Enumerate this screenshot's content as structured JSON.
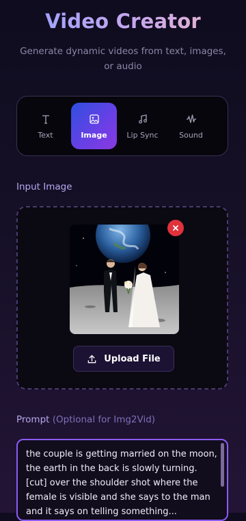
{
  "header": {
    "title": "Video Creator",
    "subtitle": "Generate dynamic videos from text, images, or audio"
  },
  "tabs": [
    {
      "label": "Text",
      "icon": "text-icon",
      "active": false
    },
    {
      "label": "Image",
      "icon": "image-icon",
      "active": true
    },
    {
      "label": "Lip Sync",
      "icon": "music-note-icon",
      "active": false
    },
    {
      "label": "Sound",
      "icon": "waveform-icon",
      "active": false
    }
  ],
  "input_image": {
    "label": "Input Image",
    "upload_label": "Upload File"
  },
  "prompt": {
    "label": "Prompt",
    "hint": "(Optional for Img2Vid)",
    "value": "the couple is getting married on the moon, the earth in the back is slowly turning. [cut] over the shoulder shot where the female is visible and she says to the man and it says on telling something..."
  },
  "colors": {
    "accent": "#8b5cf6",
    "active_tab_start": "#2f4fe0",
    "active_tab_end": "#8a3ae0",
    "remove": "#e0323c"
  }
}
